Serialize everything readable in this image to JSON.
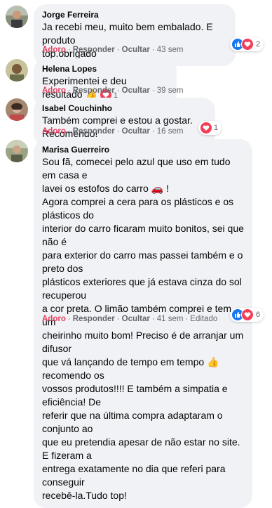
{
  "colors": {
    "bubble": "#f0f2f5",
    "love_action": "#e4405f",
    "meta": "#65676b",
    "like_blue": "#1877f2",
    "love_red": "#f33e58"
  },
  "comments": [
    {
      "author": "Jorge Ferreira",
      "lines": [
        "Ja recebi meu, muito bem embalado. E produto",
        "top.obrigado"
      ],
      "actions": {
        "reaction": "Adoro",
        "reply": "Responder",
        "hide": "Ocultar",
        "time": "43 sem"
      },
      "reactions": {
        "icons": [
          "like-icon",
          "love-icon"
        ],
        "count": "2"
      }
    },
    {
      "author": "Helena Lopes",
      "lines": [
        "Experimentei e deu resultado 👍"
      ],
      "actions": {
        "reaction": "Adoro",
        "reply": "Responder",
        "hide": "Ocultar",
        "time": "39 sem"
      },
      "reactions": {
        "icons": [
          "love-icon"
        ],
        "count": "1"
      }
    },
    {
      "author": "Isabel Couchinho",
      "lines": [
        "Também comprei e estou a gostar. Recomendo!"
      ],
      "actions": {
        "reaction": "Adoro",
        "reply": "Responder",
        "hide": "Ocultar",
        "time": "16 sem"
      },
      "reactions": {
        "icons": [
          "love-icon"
        ],
        "count": "1"
      }
    },
    {
      "author": "Marisa Guerreiro",
      "lines": [
        "Sou fã, comecei pelo azul que uso em tudo em casa e",
        "lavei os estofos do carro 🚗 !",
        "Agora comprei a cera para os plásticos e os plásticos do",
        "interior do carro ficaram muito bonitos, sei que não é",
        "para exterior do carro mas passei também e o preto dos",
        "plásticos exteriores que já estava cinza do sol recuperou",
        "a cor preta. O limão também comprei e tem um",
        "cheirinho muito bom! Preciso é de arranjar um difusor",
        "que vá lançando de tempo em tempo 👍 recomendo os",
        "vossos produtos!!!! E também a simpatia e eficiência! De",
        "referir que na última compra adaptaram o conjunto ao",
        "que eu pretendia apesar de não estar no site. E fizeram a",
        "entrega exatamente no dia que referi para conseguir",
        "recebê-la.Tudo top!"
      ],
      "actions": {
        "reaction": "Adoro",
        "reply": "Responder",
        "hide": "Ocultar",
        "time": "41 sem",
        "edited": "Editado"
      },
      "reactions": {
        "icons": [
          "like-icon",
          "love-icon"
        ],
        "count": "6"
      }
    }
  ]
}
